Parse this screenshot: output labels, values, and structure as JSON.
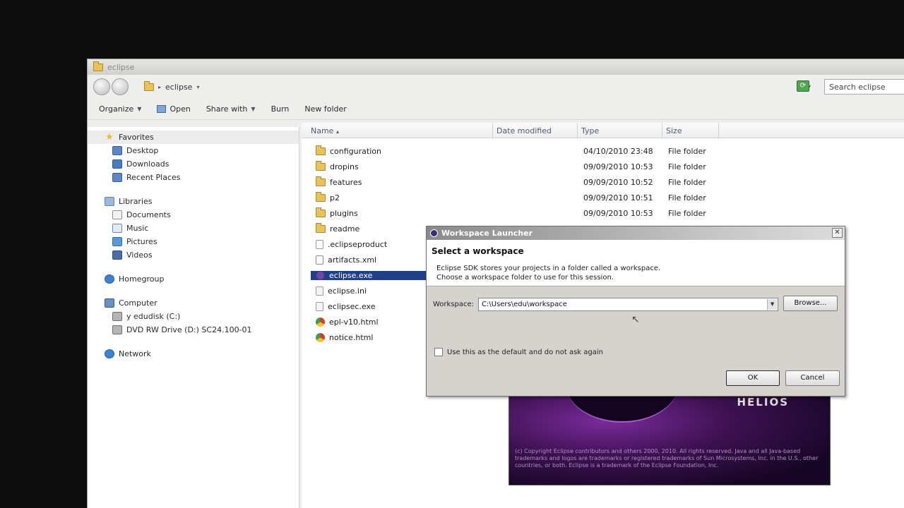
{
  "explorer": {
    "title": "eclipse",
    "address": "eclipse",
    "search_placeholder": "Search eclipse",
    "toolbar": {
      "organize": "Organize",
      "open": "Open",
      "share_with": "Share with",
      "burn": "Burn",
      "new_folder": "New folder"
    },
    "nav": {
      "favorites": "Favorites",
      "favorites_items": [
        "Desktop",
        "Downloads",
        "Recent Places"
      ],
      "libraries": "Libraries",
      "libraries_items": [
        "Documents",
        "Music",
        "Pictures",
        "Videos"
      ],
      "homegroup": "Homegroup",
      "computer": "Computer",
      "computer_items": [
        "y edudisk (C:)",
        "DVD RW Drive (D:) SC24.100-01"
      ],
      "network": "Network"
    },
    "columns": {
      "name": "Name",
      "date": "Date modified",
      "type": "Type",
      "size": "Size"
    },
    "files": [
      {
        "name": "configuration",
        "date": "04/10/2010 23:48",
        "type": "File folder",
        "icon": "folder-icon"
      },
      {
        "name": "dropins",
        "date": "09/09/2010 10:53",
        "type": "File folder",
        "icon": "folder-icon"
      },
      {
        "name": "features",
        "date": "09/09/2010 10:52",
        "type": "File folder",
        "icon": "folder-icon"
      },
      {
        "name": "p2",
        "date": "09/09/2010 10:51",
        "type": "File folder",
        "icon": "folder-icon"
      },
      {
        "name": "plugins",
        "date": "09/09/2010 10:53",
        "type": "File folder",
        "icon": "folder-icon"
      },
      {
        "name": "readme",
        "date": "",
        "type": "",
        "icon": "folder-icon"
      },
      {
        "name": ".eclipseproduct",
        "date": "",
        "type": "",
        "icon": "file-icon"
      },
      {
        "name": "artifacts.xml",
        "date": "",
        "type": "",
        "icon": "xml-file-icon"
      },
      {
        "name": "eclipse.exe",
        "date": "",
        "type": "",
        "icon": "eclipse-exe-icon",
        "selected": true
      },
      {
        "name": "eclipse.ini",
        "date": "",
        "type": "",
        "icon": "ini-file-icon"
      },
      {
        "name": "eclipsec.exe",
        "date": "",
        "type": "",
        "icon": "exe-file-icon"
      },
      {
        "name": "epl-v10.html",
        "date": "",
        "type": "",
        "icon": "html-file-icon"
      },
      {
        "name": "notice.html",
        "date": "",
        "type": "",
        "icon": "html-file-icon"
      }
    ]
  },
  "splash": {
    "wordmark": "HELIOS",
    "copyright": "(c) Copyright Eclipse contributors and others 2000, 2010. All rights reserved. Java and all Java-based trademarks and logos are trademarks or registered trademarks of Sun Microsystems, Inc. in the U.S., other countries, or both. Eclipse is a trademark of the Eclipse Foundation, Inc."
  },
  "dialog": {
    "title": "Workspace Launcher",
    "heading": "Select a workspace",
    "desc_line1": "Eclipse SDK stores your projects in a folder called a workspace.",
    "desc_line2": "Choose a workspace folder to use for this session.",
    "workspace_label": "Workspace:",
    "workspace_value": "C:\\Users\\edu\\workspace",
    "browse": "Browse...",
    "default_checkbox": "Use this as the default and do not ask again",
    "ok": "OK",
    "cancel": "Cancel"
  }
}
